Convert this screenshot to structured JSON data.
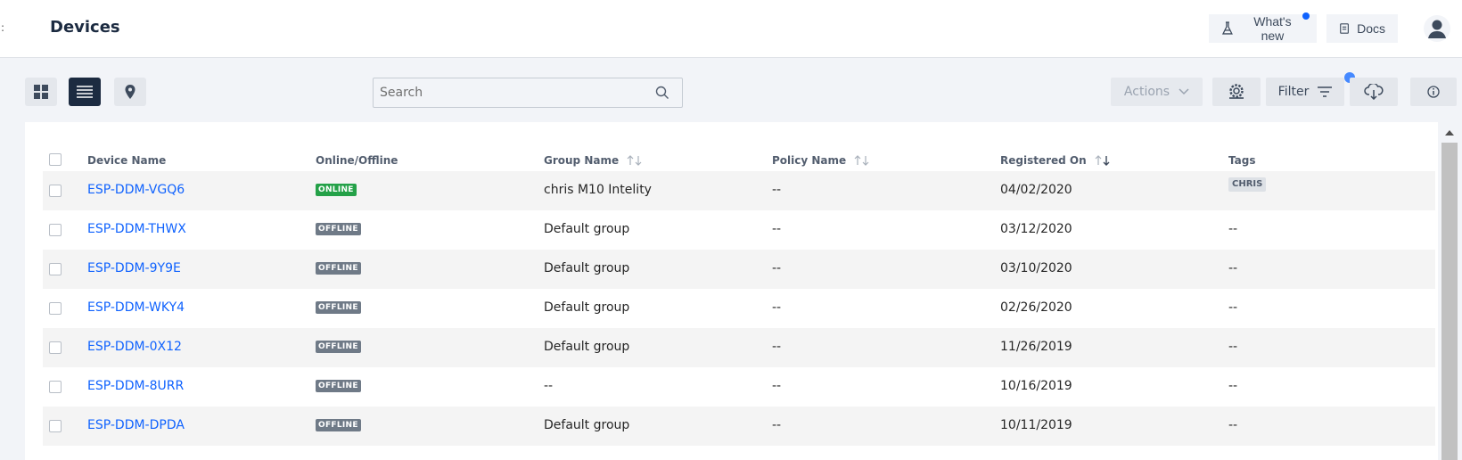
{
  "header": {
    "title": "Devices",
    "edge_glyph": ":",
    "whats_new_label": "What's new",
    "docs_label": "Docs"
  },
  "toolbar": {
    "search_placeholder": "Search",
    "actions_label": "Actions",
    "filter_label": "Filter"
  },
  "table": {
    "columns": [
      "Device Name",
      "Online/Offline",
      "Group Name",
      "Policy Name",
      "Registered On",
      "Tags"
    ],
    "rows": [
      {
        "name": "ESP-DDM-VGQ6",
        "status": "ONLINE",
        "group": "chris M10 Intelity",
        "policy": "--",
        "registered": "04/02/2020",
        "tags": "CHRIS"
      },
      {
        "name": "ESP-DDM-THWX",
        "status": "OFFLINE",
        "group": "Default group",
        "policy": "--",
        "registered": "03/12/2020",
        "tags": "--"
      },
      {
        "name": "ESP-DDM-9Y9E",
        "status": "OFFLINE",
        "group": "Default group",
        "policy": "--",
        "registered": "03/10/2020",
        "tags": "--"
      },
      {
        "name": "ESP-DDM-WKY4",
        "status": "OFFLINE",
        "group": "Default group",
        "policy": "--",
        "registered": "02/26/2020",
        "tags": "--"
      },
      {
        "name": "ESP-DDM-0X12",
        "status": "OFFLINE",
        "group": "Default group",
        "policy": "--",
        "registered": "11/26/2019",
        "tags": "--"
      },
      {
        "name": "ESP-DDM-8URR",
        "status": "OFFLINE",
        "group": "--",
        "policy": "--",
        "registered": "10/16/2019",
        "tags": "--"
      },
      {
        "name": "ESP-DDM-DPDA",
        "status": "OFFLINE",
        "group": "Default group",
        "policy": "--",
        "registered": "10/11/2019",
        "tags": "--"
      }
    ]
  },
  "colors": {
    "online": "#24a148",
    "offline": "#6f7a87",
    "link": "#0f62fe",
    "header_dark": "#1c2b41",
    "notification_dot": "#4589ff"
  }
}
